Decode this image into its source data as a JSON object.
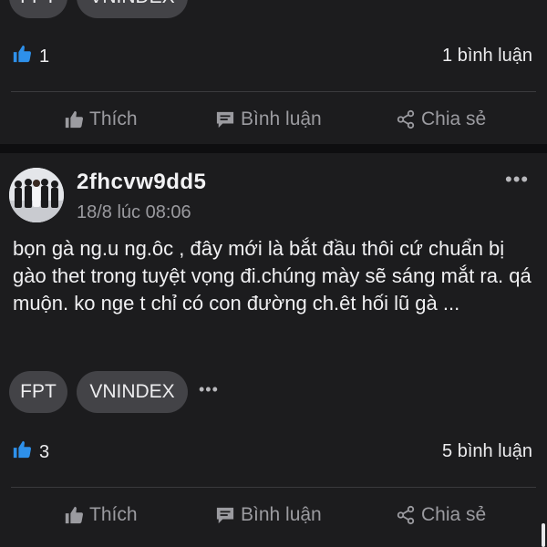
{
  "post1": {
    "tags": [
      "FPT",
      "VNINDEX"
    ],
    "like_count": "1",
    "comment_count": "1 bình luận",
    "actions": {
      "like": "Thích",
      "comment": "Bình luận",
      "share": "Chia sẻ"
    }
  },
  "post2": {
    "username": "2fhcvw9dd5",
    "timestamp": "18/8 lúc 08:06",
    "content": "bọn gà ng.u ng.ôc , đây mới là bắt đầu thôi cứ chuẩn bị gào thet trong tuyệt vọng đi.chúng mày sẽ sáng mắt ra. qá muộn. ko nge t chỉ có con đường ch.êt hối lũ gà ...",
    "tags": [
      "FPT",
      "VNINDEX"
    ],
    "like_count": "3",
    "comment_count": "5 bình luận",
    "actions": {
      "like": "Thích",
      "comment": "Bình luận",
      "share": "Chia sẻ"
    }
  },
  "colors": {
    "like_blue": "#2e90ea",
    "background": "#0e0e10",
    "card": "#1c1c1e",
    "chip": "#434347"
  },
  "icons": [
    "thumbs-up-icon",
    "comment-icon",
    "share-icon",
    "more-icon",
    "avatar"
  ]
}
